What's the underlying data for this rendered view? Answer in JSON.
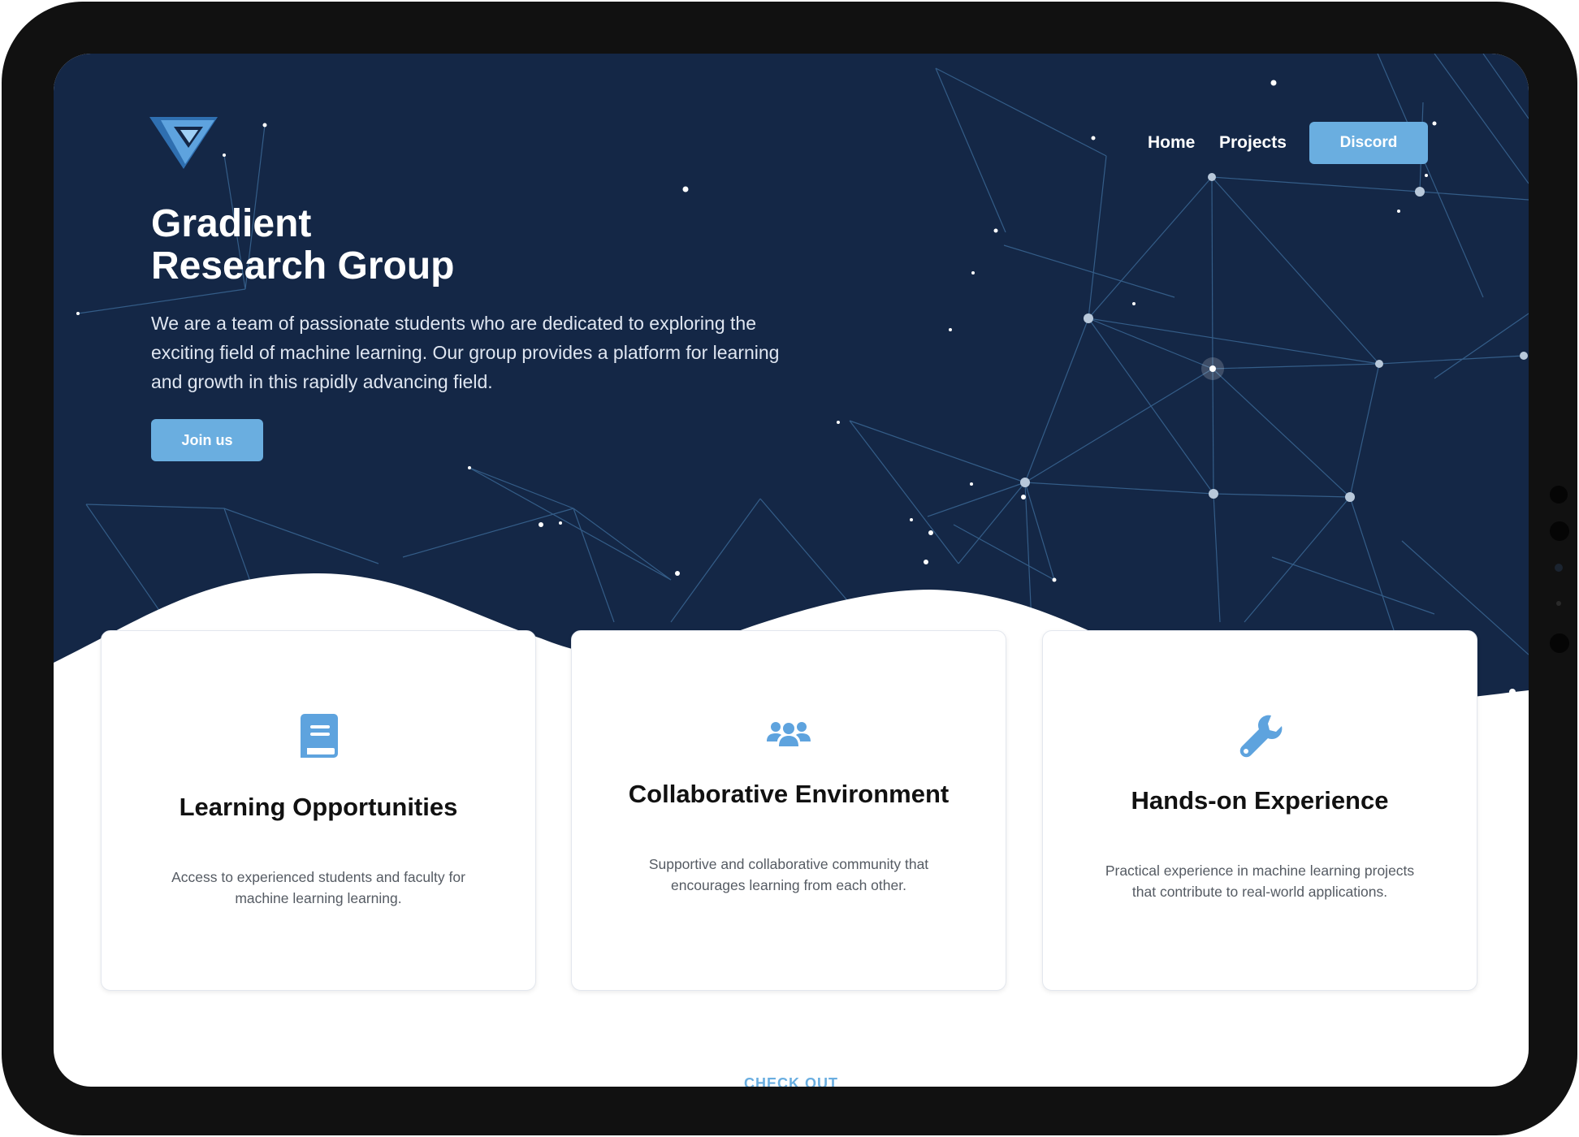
{
  "nav": {
    "home": "Home",
    "projects": "Projects",
    "discord": "Discord"
  },
  "hero": {
    "title_line1": "Gradient",
    "title_line2": "Research Group",
    "description": "We are a team of passionate students who are dedicated to exploring the exciting field of machine learning. Our group provides a platform for learning and growth in this rapidly advancing field.",
    "join_button": "Join us"
  },
  "features": [
    {
      "icon": "book-icon",
      "title": "Learning Opportunities",
      "text": "Access to experienced students and faculty for machine learning learning."
    },
    {
      "icon": "users-icon",
      "title": "Collaborative Environment",
      "text": "Supportive and collaborative community that encourages learning from each other."
    },
    {
      "icon": "wrench-icon",
      "title": "Hands-on Experience",
      "text": "Practical experience in machine learning projects that contribute to real-world applications."
    }
  ],
  "section_label": "CHECK OUT",
  "colors": {
    "hero_bg": "#142746",
    "accent": "#6aaee0",
    "card_border": "#e3e7ee"
  }
}
